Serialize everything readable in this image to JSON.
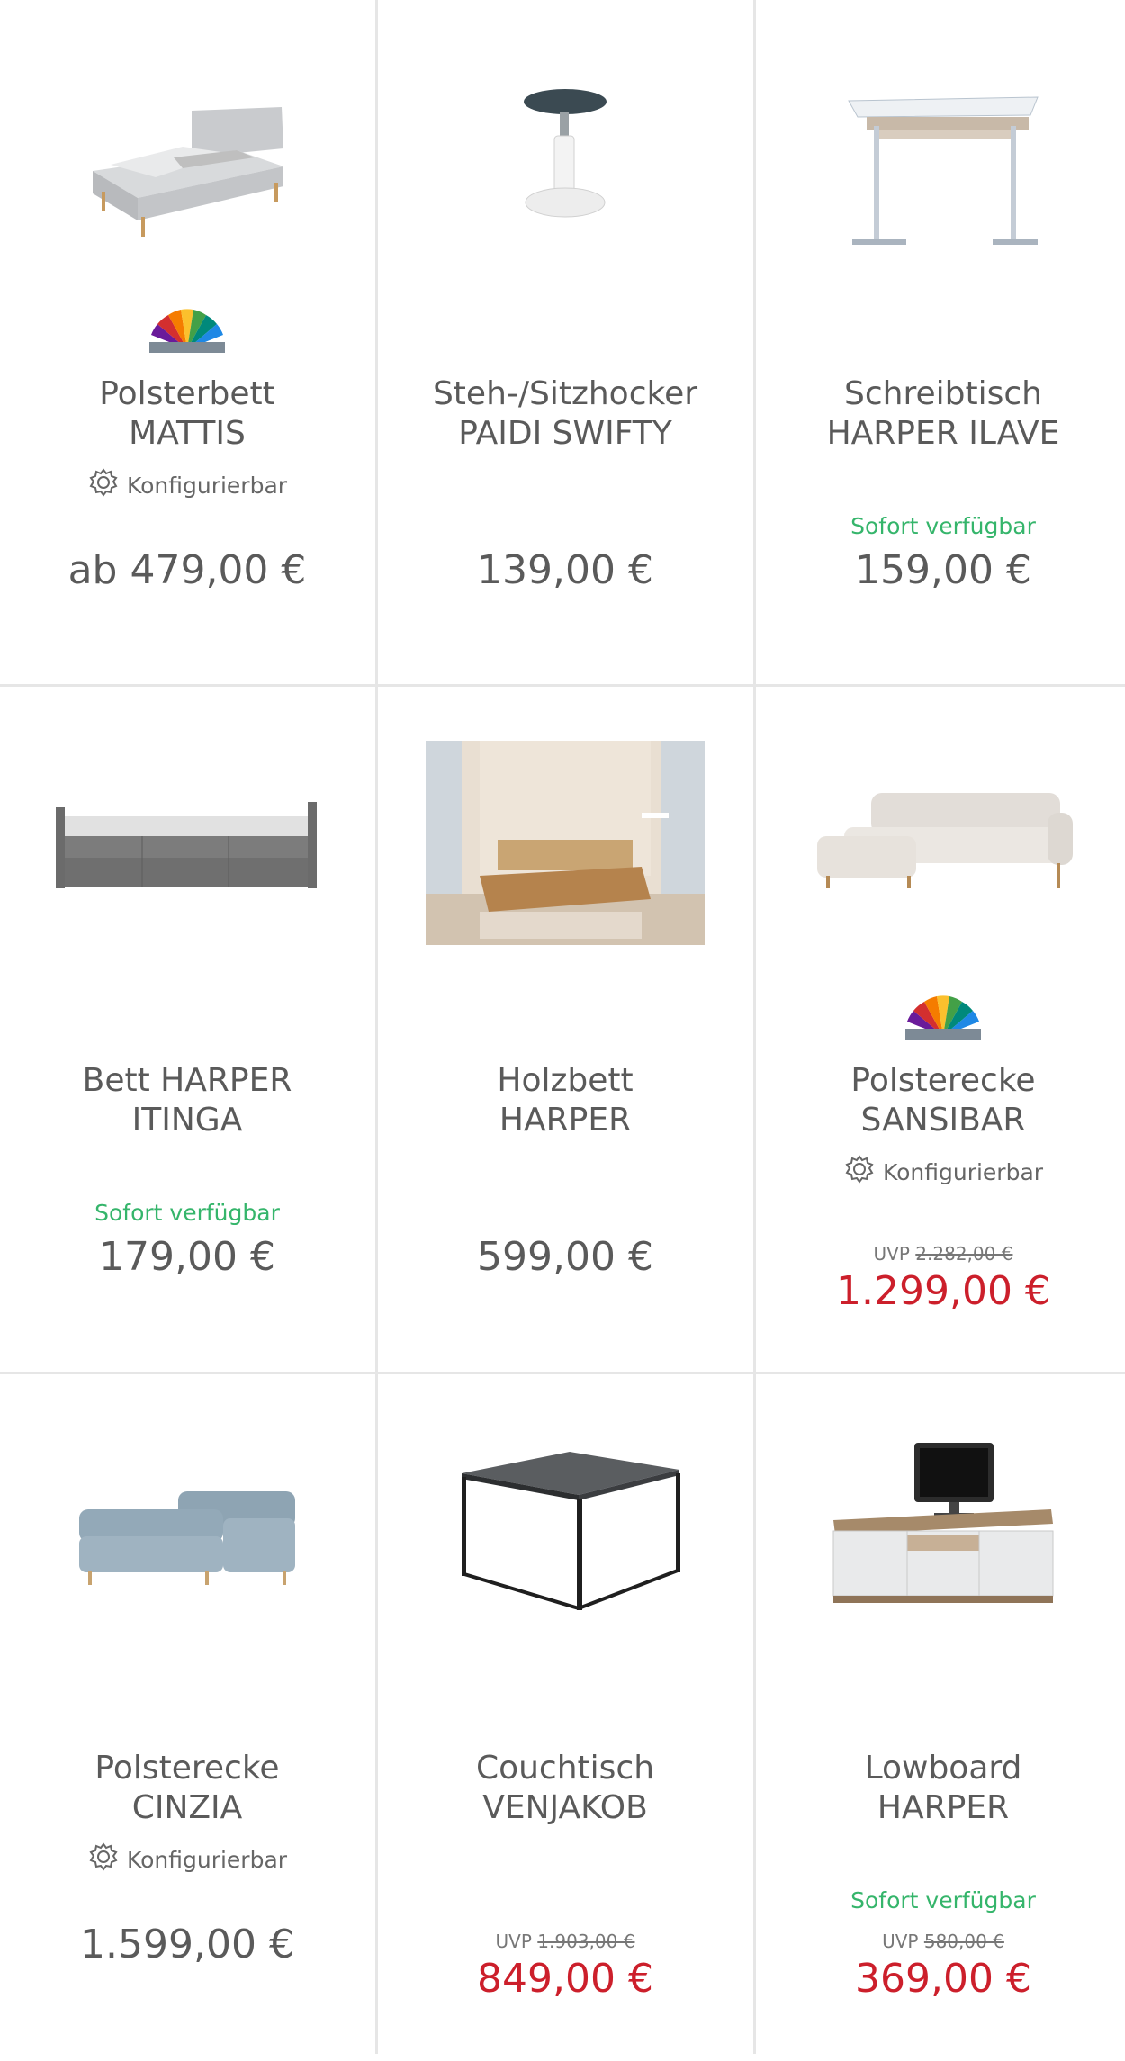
{
  "products": [
    {
      "title_line1": "Polsterbett",
      "title_line2": "MATTIS",
      "config_label": "Konfigurierbar",
      "price": "ab 479,00 €",
      "image": "upholstered-bed-image"
    },
    {
      "title_line1": "Steh-/Sitzhocker",
      "title_line2": "PAIDI SWIFTY",
      "price": "139,00 €",
      "image": "stool-image"
    },
    {
      "title_line1": "Schreibtisch",
      "title_line2": "HARPER ILAVE",
      "availability": "Sofort verfügbar",
      "price": "159,00 €",
      "image": "desk-image"
    },
    {
      "title_line1": "Bett HARPER",
      "title_line2": "ITINGA",
      "availability": "Sofort verfügbar",
      "price": "179,00 €",
      "image": "bed-with-drawers-image"
    },
    {
      "title_line1": "Holzbett",
      "title_line2": "HARPER",
      "price": "599,00 €",
      "image": "wooden-bed-room-image"
    },
    {
      "title_line1": "Polsterecke",
      "title_line2": "SANSIBAR",
      "config_label": "Konfigurierbar",
      "uvp_label": "UVP",
      "uvp_price": "2.282,00 €",
      "price": "1.299,00 €",
      "image": "corner-sofa-beige-image"
    },
    {
      "title_line1": "Polsterecke",
      "title_line2": "CINZIA",
      "config_label": "Konfigurierbar",
      "price": "1.599,00 €",
      "image": "corner-sofa-blue-image"
    },
    {
      "title_line1": "Couchtisch",
      "title_line2": "VENJAKOB",
      "uvp_label": "UVP",
      "uvp_price": "1.903,00 €",
      "price": "849,00 €",
      "image": "coffee-table-image"
    },
    {
      "title_line1": "Lowboard",
      "title_line2": "HARPER",
      "availability": "Sofort verfügbar",
      "uvp_label": "UVP",
      "uvp_price": "580,00 €",
      "price": "369,00 €",
      "image": "tv-lowboard-image"
    }
  ],
  "colors": {
    "available": "#35b56b",
    "sale": "#cc1f2b",
    "text": "#5a5a5a",
    "divider": "#e6e6e6"
  }
}
